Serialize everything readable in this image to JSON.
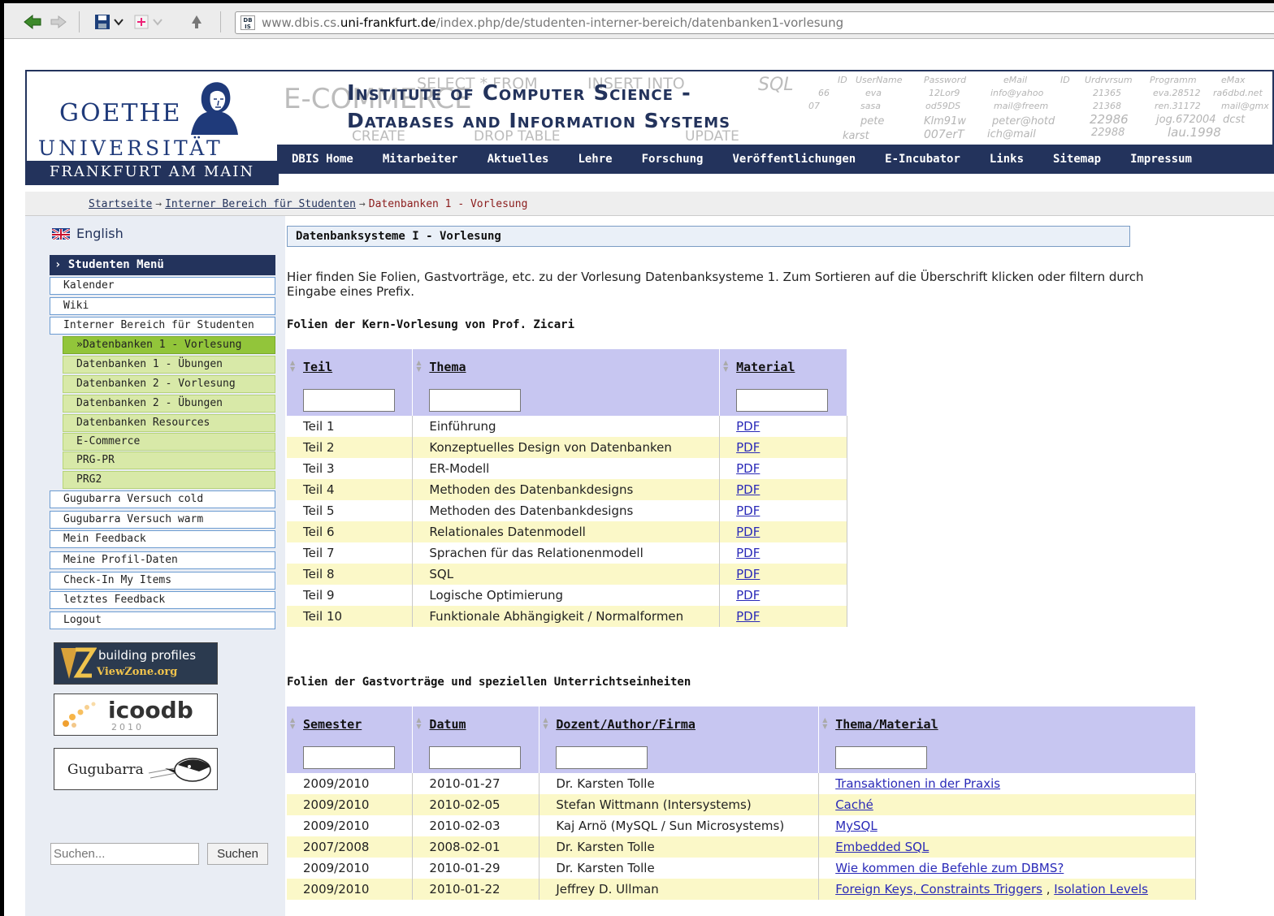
{
  "browser": {
    "url_prefix": "www.dbis.cs.",
    "url_domain": "uni-frankfurt.de",
    "url_path": "/index.php/de/studenten-interner-bereich/datenbanken1-vorlesung",
    "favicon_text": "DB IS"
  },
  "header": {
    "logo_line1": "GOETHE",
    "logo_line2": "UNIVERSITÄT",
    "logo_line3": "FRANKFURT AM MAIN",
    "title_line1": "Institute of Computer Science -",
    "title_line2": "Databases and Information Systems",
    "banner_words": [
      "E-COMMERCE",
      "SELECT * FROM",
      "INSERT INTO",
      "SQL",
      "CREATE",
      "DROP TABLE",
      "UPDATE"
    ],
    "banner_table": {
      "columns": [
        "ID",
        "UserName",
        "Password",
        "eMail",
        "ID",
        "Urdrvrsum",
        "Programm",
        "eMax"
      ],
      "rows": [
        [
          "66",
          "eva",
          "12Lor9",
          "info@yahoo",
          "21365",
          "eva.28512",
          "ra6dbd.net"
        ],
        [
          "07",
          "sasa",
          "od59DS",
          "mail@freem",
          "21368",
          "ren.31172",
          "mail@gmx"
        ],
        [
          "",
          "pete",
          "Klm91w",
          "peter@hotd",
          "22986",
          "jog.672004",
          "dcst"
        ],
        [
          "",
          "karst",
          "007erT",
          "ich@mail",
          "22988",
          "lau.1998",
          ""
        ]
      ]
    }
  },
  "nav": {
    "items": [
      "DBIS Home",
      "Mitarbeiter",
      "Aktuelles",
      "Lehre",
      "Forschung",
      "Veröffentlichungen",
      "E-Incubator",
      "Links",
      "Sitemap",
      "Impressum"
    ]
  },
  "breadcrumb": {
    "items": [
      "Startseite",
      "Interner Bereich für Studenten"
    ],
    "current": "Datenbanken 1 - Vorlesung",
    "separator": "→"
  },
  "sidebar": {
    "language": "English",
    "menu_title": "Studenten Menü",
    "items": [
      "Kalender",
      "Wiki",
      "Interner Bereich für Studenten",
      "»Datenbanken 1 - Vorlesung",
      "Datenbanken 1 - Übungen",
      "Datenbanken 2 - Vorlesung",
      "Datenbanken 2 - Übungen",
      "Datenbanken Resources",
      "E-Commerce",
      "PRG-PR",
      "PRG2",
      "Gugubarra Versuch cold",
      "Gugubarra Versuch warm",
      "Mein Feedback",
      "Meine Profil-Daten",
      "Check-In My Items",
      "letztes Feedback",
      "Logout"
    ],
    "badges": {
      "viewzone_line1": "building profiles",
      "viewzone_line2": "ViewZone.org",
      "icoodb": "icoodb",
      "icoodb_year": "2010",
      "gugubarra": "Gugubarra"
    },
    "search_placeholder": "Suchen...",
    "search_button": "Suchen"
  },
  "content": {
    "title": "Datenbanksysteme I - Vorlesung",
    "intro": "Hier finden Sie Folien, Gastvorträge, etc. zu der Vorlesung Datenbanksysteme 1. Zum Sortieren auf die Überschrift klicken oder filtern durch Eingabe eines Prefix.",
    "section1": "Folien der Kern-Vorlesung von Prof. Zicari",
    "table1": {
      "headers": [
        "Teil",
        "Thema",
        "Material"
      ],
      "rows": [
        [
          "Teil 1",
          "Einführung",
          "PDF"
        ],
        [
          "Teil 2",
          "Konzeptuelles Design von Datenbanken",
          "PDF"
        ],
        [
          "Teil 3",
          "ER-Modell",
          "PDF"
        ],
        [
          "Teil 4",
          "Methoden des Datenbankdesigns",
          "PDF"
        ],
        [
          "Teil 5",
          "Methoden des Datenbankdesigns",
          "PDF"
        ],
        [
          "Teil 6",
          "Relationales Datenmodell",
          "PDF"
        ],
        [
          "Teil 7",
          "Sprachen für das Relationenmodell",
          "PDF"
        ],
        [
          "Teil 8",
          "SQL",
          "PDF"
        ],
        [
          "Teil 9",
          "Logische Optimierung",
          "PDF"
        ],
        [
          "Teil 10",
          "Funktionale Abhängigkeit / Normalformen",
          "PDF"
        ]
      ]
    },
    "section2": "Folien der Gastvorträge und speziellen Unterrichtseinheiten",
    "table2": {
      "headers": [
        "Semester",
        "Datum",
        "Dozent/Author/Firma",
        "Thema/Material"
      ],
      "rows": [
        [
          "2009/2010",
          "2010-01-27",
          "Dr. Karsten Tolle",
          "Transaktionen in der Praxis"
        ],
        [
          "2009/2010",
          "2010-02-05",
          "Stefan Wittmann (Intersystems)",
          "Caché"
        ],
        [
          "2009/2010",
          "2010-02-03",
          "Kaj Arnö (MySQL / Sun Microsystems)",
          "MySQL"
        ],
        [
          "2007/2008",
          "2008-02-01",
          "Dr. Karsten Tolle",
          "Embedded SQL"
        ],
        [
          "2009/2010",
          "2010-01-29",
          "Dr. Karsten Tolle",
          "Wie kommen die Befehle zum DBMS?"
        ],
        [
          "2009/2010",
          "2010-01-22",
          "Jeffrey D. Ullman",
          "Foreign Keys, Constraints Triggers"
        ]
      ],
      "extra_link_separator": " , ",
      "extra_link": "Isolation Levels"
    }
  },
  "colors": {
    "navy": "#23335c",
    "table_header": "#c7c6f1",
    "row_alt": "#fbf8c8",
    "sub_menu": "#d8e9a8",
    "active_menu": "#92c53a"
  }
}
